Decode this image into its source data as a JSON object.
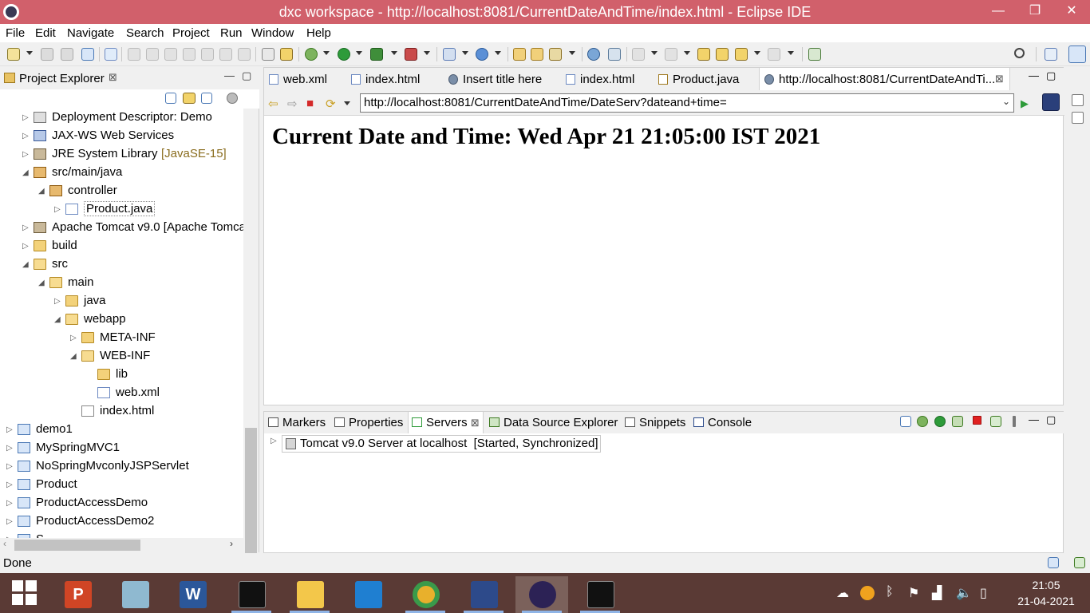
{
  "window": {
    "title": "dxc workspace - http://localhost:8081/CurrentDateAndTime/index.html - Eclipse IDE",
    "minimize_glyph": "—",
    "maximize_glyph": "❐",
    "close_glyph": "✕"
  },
  "menubar": {
    "items": [
      "File",
      "Edit",
      "Navigate",
      "Search",
      "Project",
      "Run",
      "Window",
      "Help"
    ]
  },
  "explorer": {
    "tab_label": "Project Explorer",
    "close_glyph": "⊠",
    "minimize_glyph": "—",
    "maximize_glyph": "▢",
    "tree": [
      {
        "label": "Deployment Descriptor: Demo",
        "decoration": "",
        "twisty": "▷",
        "icon": "deployment-descriptor-icon"
      },
      {
        "label": "JAX-WS Web Services",
        "decoration": "",
        "twisty": "▷",
        "icon": "web-services-icon"
      },
      {
        "label": "JRE System Library",
        "decoration": "[JavaSE-15]",
        "twisty": "▷",
        "icon": "library-icon"
      },
      {
        "label": "src/main/java",
        "decoration": "",
        "twisty": "◢",
        "icon": "source-folder-icon"
      },
      {
        "label": "controller",
        "decoration": "",
        "twisty": "◢",
        "icon": "package-icon"
      },
      {
        "label": "Product.java",
        "decoration": "",
        "twisty": "▷",
        "icon": "java-file-icon"
      },
      {
        "label": "Apache Tomcat v9.0 [Apache Tomca",
        "decoration": "",
        "twisty": "▷",
        "icon": "library-icon"
      },
      {
        "label": "build",
        "decoration": "",
        "twisty": "▷",
        "icon": "folder-icon"
      },
      {
        "label": "src",
        "decoration": "",
        "twisty": "◢",
        "icon": "folder-open-icon"
      },
      {
        "label": "main",
        "decoration": "",
        "twisty": "◢",
        "icon": "folder-open-icon"
      },
      {
        "label": "java",
        "decoration": "",
        "twisty": "▷",
        "icon": "folder-icon"
      },
      {
        "label": "webapp",
        "decoration": "",
        "twisty": "◢",
        "icon": "folder-open-icon"
      },
      {
        "label": "META-INF",
        "decoration": "",
        "twisty": "▷",
        "icon": "folder-icon"
      },
      {
        "label": "WEB-INF",
        "decoration": "",
        "twisty": "◢",
        "icon": "folder-open-icon"
      },
      {
        "label": "lib",
        "decoration": "",
        "twisty": "",
        "icon": "folder-icon"
      },
      {
        "label": "web.xml",
        "decoration": "",
        "twisty": "",
        "icon": "xml-file-icon"
      },
      {
        "label": "index.html",
        "decoration": "",
        "twisty": "",
        "icon": "html-file-icon"
      },
      {
        "label": "demo1",
        "decoration": "",
        "twisty": "▷",
        "icon": "project-icon"
      },
      {
        "label": "MySpringMVC1",
        "decoration": "",
        "twisty": "▷",
        "icon": "project-icon"
      },
      {
        "label": "NoSpringMvconlyJSPServlet",
        "decoration": "",
        "twisty": "▷",
        "icon": "project-icon"
      },
      {
        "label": "Product",
        "decoration": "",
        "twisty": "▷",
        "icon": "project-icon"
      },
      {
        "label": "ProductAccessDemo",
        "decoration": "",
        "twisty": "▷",
        "icon": "project-icon"
      },
      {
        "label": "ProductAccessDemo2",
        "decoration": "",
        "twisty": "▷",
        "icon": "project-icon"
      },
      {
        "label": "S",
        "decoration": "",
        "twisty": "▷",
        "icon": "project-icon"
      }
    ]
  },
  "editor": {
    "tabs": [
      {
        "label": "web.xml",
        "icon": "xml-file-icon",
        "active": false
      },
      {
        "label": "index.html",
        "icon": "html-file-icon",
        "active": false
      },
      {
        "label": "Insert title here",
        "icon": "globe-icon",
        "active": false
      },
      {
        "label": "index.html",
        "icon": "html-file-icon",
        "active": false
      },
      {
        "label": "Product.java",
        "icon": "java-file-icon",
        "active": false
      },
      {
        "label": "http://localhost:8081/CurrentDateAndTi...",
        "icon": "globe-icon",
        "active": true
      }
    ],
    "tab_close_glyph": "⊠",
    "browser": {
      "url": "http://localhost:8081/CurrentDateAndTime/DateServ?dateand+time=",
      "back_glyph": "⇦",
      "forward_glyph": "⇨",
      "stop_glyph": "■",
      "refresh_glyph": "⟳",
      "go_glyph": "▶",
      "dropdown_glyph": "⌄",
      "page_heading": "Current Date and Time: Wed Apr 21 21:05:00 IST 2021"
    }
  },
  "bottom": {
    "tabs": [
      {
        "label": "Markers",
        "active": false
      },
      {
        "label": "Properties",
        "active": false
      },
      {
        "label": "Servers",
        "active": true
      },
      {
        "label": "Data Source Explorer",
        "active": false
      },
      {
        "label": "Snippets",
        "active": false
      },
      {
        "label": "Console",
        "active": false
      }
    ],
    "tab_close_glyph": "⊠",
    "server_label": "Tomcat v9.0 Server at localhost",
    "server_state": "[Started, Synchronized]",
    "server_twisty": "▷"
  },
  "status": {
    "text": "Done"
  },
  "taskbar": {
    "clock_time": "21:05",
    "clock_date": "21-04-2021"
  },
  "colors": {
    "titlebar": "#d1606b",
    "taskbar": "#5a3a35",
    "accent": "#4a78b5"
  }
}
